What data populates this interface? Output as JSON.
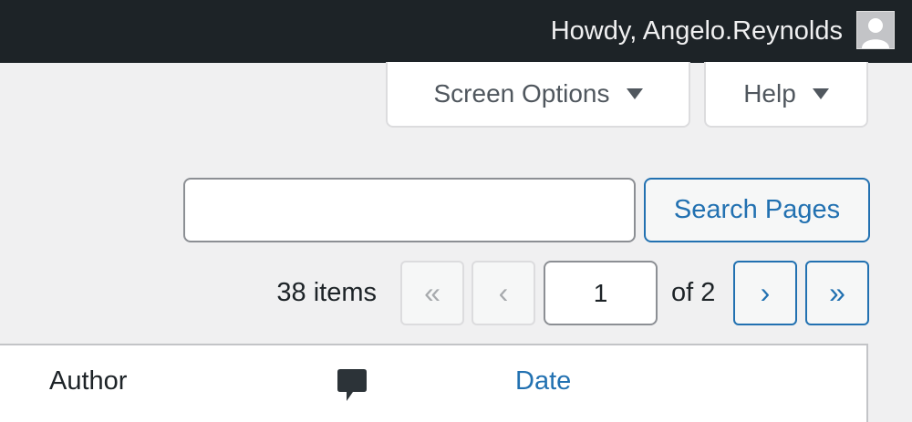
{
  "admin_bar": {
    "greeting": "Howdy, Angelo.Reynolds",
    "avatar_icon": "user-avatar-icon"
  },
  "screen_meta": {
    "screen_options_label": "Screen Options",
    "help_label": "Help",
    "toggle_icon": "triangle-down-icon"
  },
  "search": {
    "value": "",
    "placeholder": "",
    "button_label": "Search Pages"
  },
  "pagination": {
    "items_count": "38 items",
    "first_label": "«",
    "prev_label": "‹",
    "current_page": "1",
    "of_total": "of 2",
    "next_label": "›",
    "last_label": "»"
  },
  "table": {
    "columns": [
      {
        "label": "Author",
        "sortable": false
      },
      {
        "icon": "comment-bubble-icon"
      },
      {
        "label": "Date",
        "sortable": true
      }
    ]
  },
  "colors": {
    "admin_bar_bg": "#1d2327",
    "link_blue": "#2271b1",
    "page_bg": "#f0f0f1"
  }
}
